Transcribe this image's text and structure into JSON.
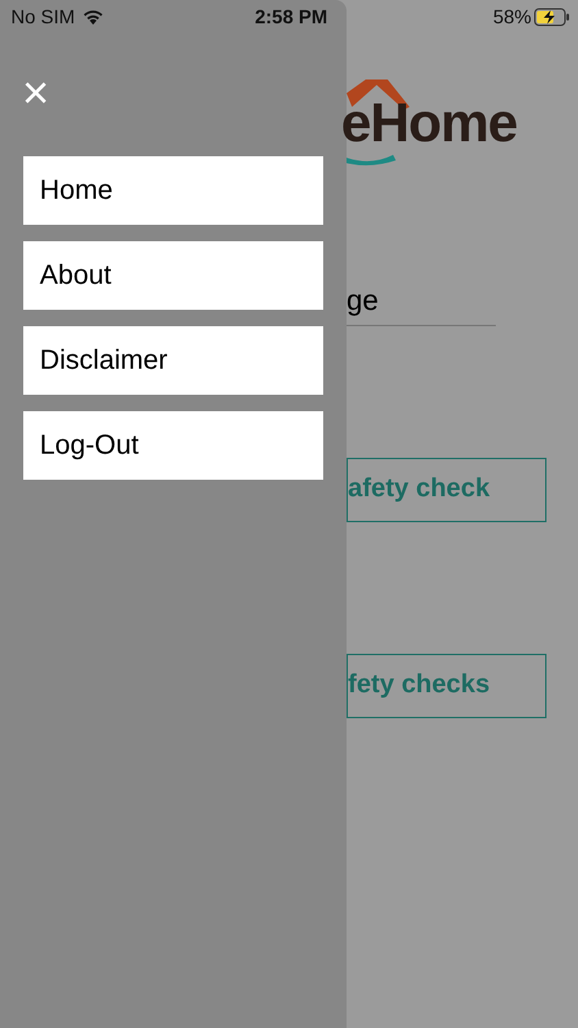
{
  "status_bar": {
    "carrier": "No SIM",
    "time": "2:58 PM",
    "battery": "58%",
    "charging": true
  },
  "drawer": {
    "close": "×",
    "items": [
      {
        "label": "Home"
      },
      {
        "label": "About"
      },
      {
        "label": "Disclaimer"
      },
      {
        "label": "Log-Out"
      }
    ]
  },
  "background": {
    "logo_text": "eHome",
    "field_value": "ge",
    "buttons": [
      "afety check",
      "fety checks"
    ]
  }
}
